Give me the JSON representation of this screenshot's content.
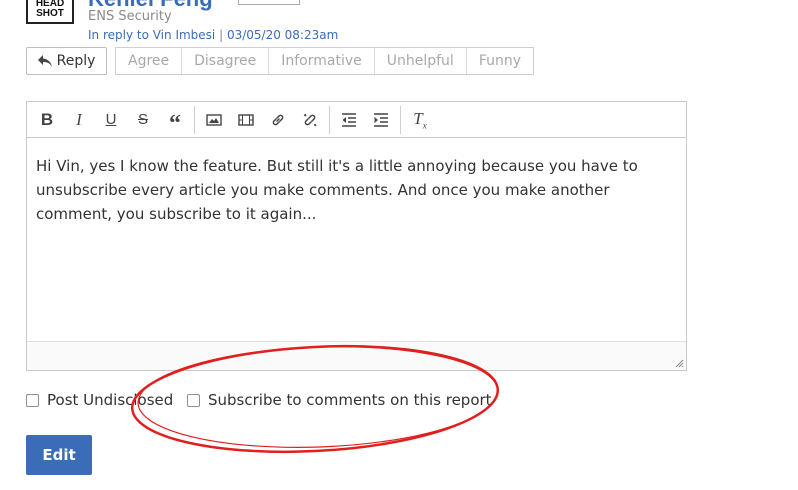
{
  "author": {
    "headshot_line1": "HEAD",
    "headshot_line2": "SHOT",
    "name": "Kenlei Feng",
    "company": "ENS Security",
    "reply_prefix": "In reply to Vin Imbesi",
    "separator": " | ",
    "timestamp": "03/05/20 08:23am"
  },
  "actions": {
    "reply_label": "Reply",
    "reactions": [
      "Agree",
      "Disagree",
      "Informative",
      "Unhelpful",
      "Funny"
    ]
  },
  "editor": {
    "toolbar_icons": [
      "bold-icon",
      "italic-icon",
      "underline-icon",
      "strikethrough-icon",
      "blockquote-icon",
      "image-icon",
      "video-icon",
      "link-icon",
      "unlink-icon",
      "outdent-icon",
      "indent-icon",
      "clear-format-icon"
    ],
    "content": "Hi Vin, yes I know the feature. But still it's a little annoying because you have to unsubscribe every article you make comments. And once you make another comment, you subscribe to it again..."
  },
  "options": {
    "post_undisclosed": "Post Undisclosed",
    "subscribe": "Subscribe to comments on this report"
  },
  "submit": {
    "edit_label": "Edit"
  },
  "colors": {
    "accent": "#3b6cb7",
    "annotation": "#e0201e"
  }
}
